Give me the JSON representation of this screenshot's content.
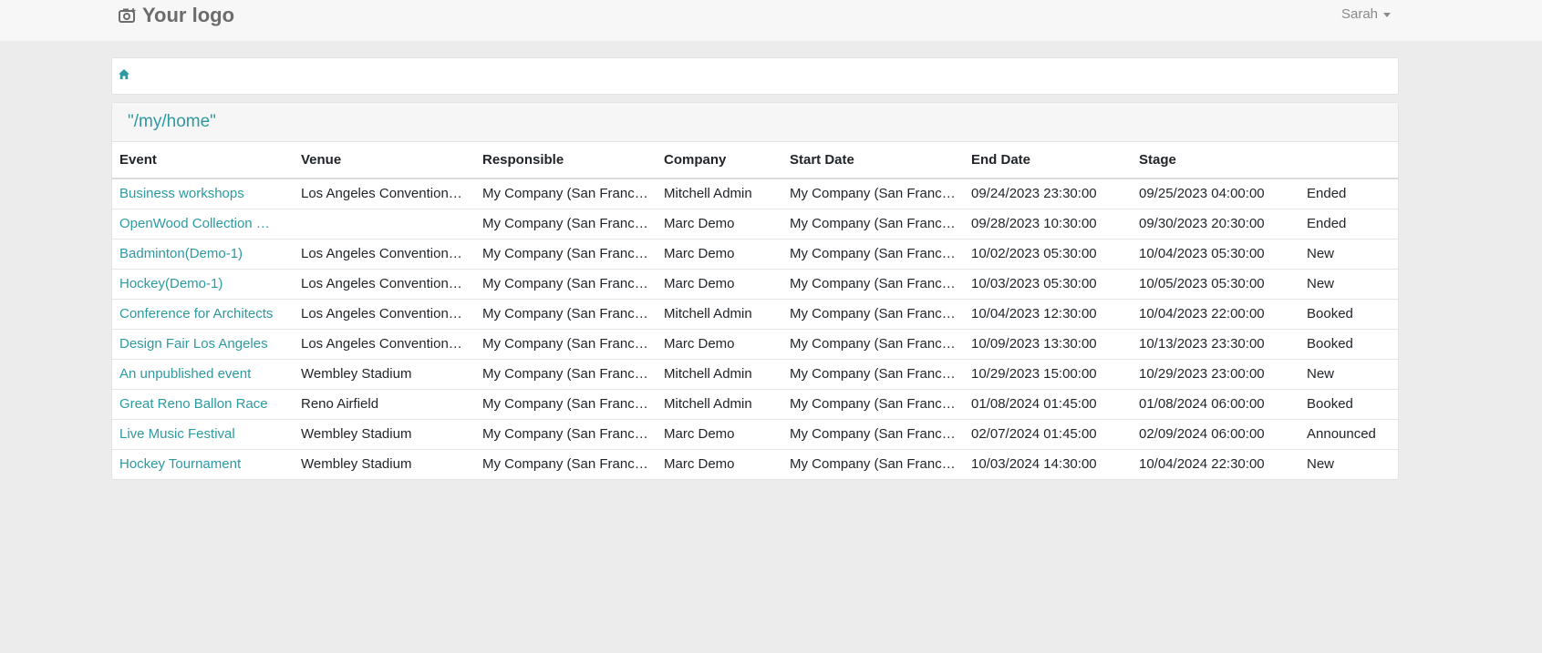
{
  "header": {
    "logo_text": "Your logo",
    "logo_icon": "camera-icon",
    "user_name": "Sarah"
  },
  "breadcrumb": {
    "home_icon": "home-icon"
  },
  "page": {
    "title": "\"/my/home\""
  },
  "colors": {
    "accent": "#2c9aa0",
    "background": "#ececec"
  },
  "table": {
    "columns": [
      "Event",
      "Venue",
      "Responsible",
      "Company",
      "Start Date",
      "End Date",
      "Stage",
      ""
    ],
    "rows": [
      [
        "Business workshops",
        "Los Angeles Convention…",
        "My Company (San Franc…",
        "Mitchell Admin",
        "My Company (San Franc…",
        "09/24/2023 23:30:00",
        "09/25/2023 04:00:00",
        "Ended"
      ],
      [
        "OpenWood Collection …",
        "",
        "My Company (San Franc…",
        "Marc Demo",
        "My Company (San Franc…",
        "09/28/2023 10:30:00",
        "09/30/2023 20:30:00",
        "Ended"
      ],
      [
        "Badminton(Demo-1)",
        "Los Angeles Convention…",
        "My Company (San Franc…",
        "Marc Demo",
        "My Company (San Franc…",
        "10/02/2023 05:30:00",
        "10/04/2023 05:30:00",
        "New"
      ],
      [
        "Hockey(Demo-1)",
        "Los Angeles Convention…",
        "My Company (San Franc…",
        "Marc Demo",
        "My Company (San Franc…",
        "10/03/2023 05:30:00",
        "10/05/2023 05:30:00",
        "New"
      ],
      [
        "Conference for Architects",
        "Los Angeles Convention…",
        "My Company (San Franc…",
        "Mitchell Admin",
        "My Company (San Franc…",
        "10/04/2023 12:30:00",
        "10/04/2023 22:00:00",
        "Booked"
      ],
      [
        "Design Fair Los Angeles",
        "Los Angeles Convention…",
        "My Company (San Franc…",
        "Marc Demo",
        "My Company (San Franc…",
        "10/09/2023 13:30:00",
        "10/13/2023 23:30:00",
        "Booked"
      ],
      [
        "An unpublished event",
        "Wembley Stadium",
        "My Company (San Franc…",
        "Mitchell Admin",
        "My Company (San Franc…",
        "10/29/2023 15:00:00",
        "10/29/2023 23:00:00",
        "New"
      ],
      [
        "Great Reno Ballon Race",
        "Reno Airfield",
        "My Company (San Franc…",
        "Mitchell Admin",
        "My Company (San Franc…",
        "01/08/2024 01:45:00",
        "01/08/2024 06:00:00",
        "Booked"
      ],
      [
        "Live Music Festival",
        "Wembley Stadium",
        "My Company (San Franc…",
        "Marc Demo",
        "My Company (San Franc…",
        "02/07/2024 01:45:00",
        "02/09/2024 06:00:00",
        "Announced"
      ],
      [
        "Hockey Tournament",
        "Wembley Stadium",
        "My Company (San Franc…",
        "Marc Demo",
        "My Company (San Franc…",
        "10/03/2024 14:30:00",
        "10/04/2024 22:30:00",
        "New"
      ]
    ]
  }
}
